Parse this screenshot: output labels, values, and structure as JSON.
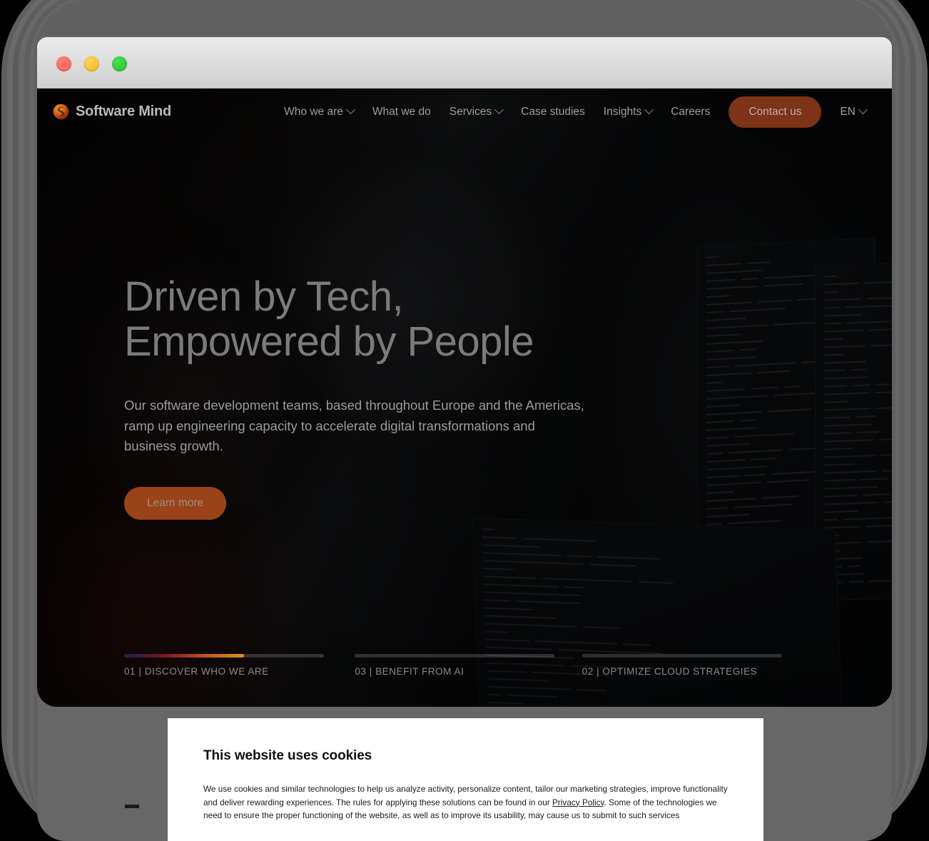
{
  "browser": {
    "traffic_lights": [
      {
        "name": "close",
        "color": "#fb5c52"
      },
      {
        "name": "minimize",
        "color": "#f7ba17"
      },
      {
        "name": "zoom",
        "color": "#1dc22c"
      }
    ]
  },
  "site_header": {
    "logo_text": "Software Mind",
    "nav_items": [
      {
        "label": "Who we are",
        "has_dropdown": true
      },
      {
        "label": "What we do",
        "has_dropdown": false
      },
      {
        "label": "Services",
        "has_dropdown": true
      },
      {
        "label": "Case studies",
        "has_dropdown": false
      },
      {
        "label": "Insights",
        "has_dropdown": true
      },
      {
        "label": "Careers",
        "has_dropdown": false
      }
    ],
    "cta_label": "Contact us",
    "language": "EN",
    "accent_color": "#7c3317"
  },
  "hero": {
    "title": "Driven by Tech,\nEmpowered by People",
    "subtitle": "Our software development teams, based throughout Europe and the Americas, ramp up engineering capacity to accelerate digital transformations and business growth.",
    "button_label": "Learn more",
    "button_color": "#9a4318"
  },
  "carousel": {
    "slides": [
      {
        "number": "01",
        "label": "01 | DISCOVER WHO WE ARE",
        "progress": 60,
        "active": true
      },
      {
        "number": "03",
        "label": "03 | BENEFIT FROM AI",
        "progress": 0,
        "active": false
      },
      {
        "number": "02",
        "label": "02 | OPTIMIZE CLOUD STRATEGIES",
        "progress": 0,
        "active": false
      }
    ],
    "fill_gradient": [
      "#1c2350",
      "#7a1326",
      "#c1521a",
      "#d79420"
    ]
  },
  "cookie_banner": {
    "title": "This website uses cookies",
    "body_part1": "We use cookies and similar technologies to help us analyze activity, personalize content, tailor our marketing strategies, improve functionality and deliver rewarding experiences. The rules for applying these solutions can be found in our ",
    "privacy_link": "Privacy Policy",
    "body_part2": ". Some of the",
    "body_line3": "technologies we need to ensure the proper functioning of the website, as well as to improve its usability, may cause us to submit to such services"
  }
}
